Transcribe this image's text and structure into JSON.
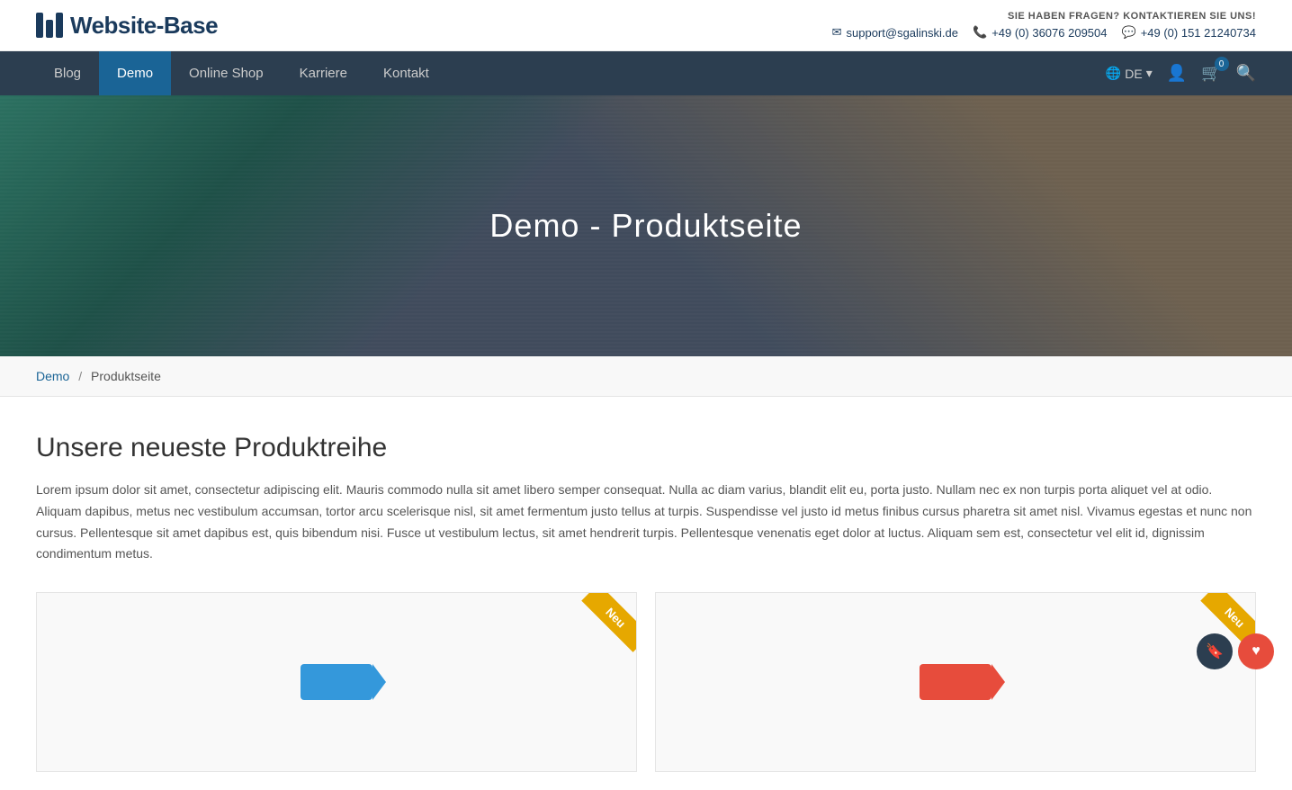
{
  "header": {
    "logo_text": "Website-Base",
    "contact_label": "SIE HABEN FRAGEN? KONTAKTIEREN SIE UNS!",
    "email": "support@sgalinski.de",
    "phone": "+49 (0) 36076 209504",
    "whatsapp": "+49 (0) 151 21240734"
  },
  "nav": {
    "items": [
      {
        "label": "Blog",
        "active": false
      },
      {
        "label": "Demo",
        "active": true
      },
      {
        "label": "Online Shop",
        "active": false
      },
      {
        "label": "Karriere",
        "active": false
      },
      {
        "label": "Kontakt",
        "active": false
      }
    ],
    "lang": "DE",
    "cart_count": "0"
  },
  "hero": {
    "title": "Demo - Produktseite"
  },
  "breadcrumb": {
    "items": [
      {
        "label": "Demo",
        "link": true
      },
      {
        "label": "Produktseite",
        "link": false
      }
    ]
  },
  "main": {
    "section_title": "Unsere neueste Produktreihe",
    "section_desc": "Lorem ipsum dolor sit amet, consectetur adipiscing elit. Mauris commodo nulla sit amet libero semper consequat. Nulla ac diam varius, blandit elit eu, porta justo. Nullam nec ex non turpis porta aliquet vel at odio. Aliquam dapibus, metus nec vestibulum accumsan, tortor arcu scelerisque nisl, sit amet fermentum justo tellus at turpis. Suspendisse vel justo id metus finibus cursus pharetra sit amet nisl. Vivamus egestas et nunc non cursus. Pellentesque sit amet dapibus est, quis bibendum nisi. Fusce ut vestibulum lectus, sit amet hendrerit turpis. Pellentesque venenatis eget dolor at luctus. Aliquam sem est, consectetur vel elit id, dignissim condimentum metus.",
    "products": [
      {
        "badge": "Neu"
      },
      {
        "badge": "Neu"
      }
    ]
  },
  "icons": {
    "envelope": "✉",
    "phone": "📞",
    "whatsapp": "💬",
    "globe": "🌐",
    "user": "👤",
    "cart": "🛒",
    "search": "🔍",
    "chevron_down": "▾",
    "bookmark": "🔖",
    "heart": "♥"
  }
}
